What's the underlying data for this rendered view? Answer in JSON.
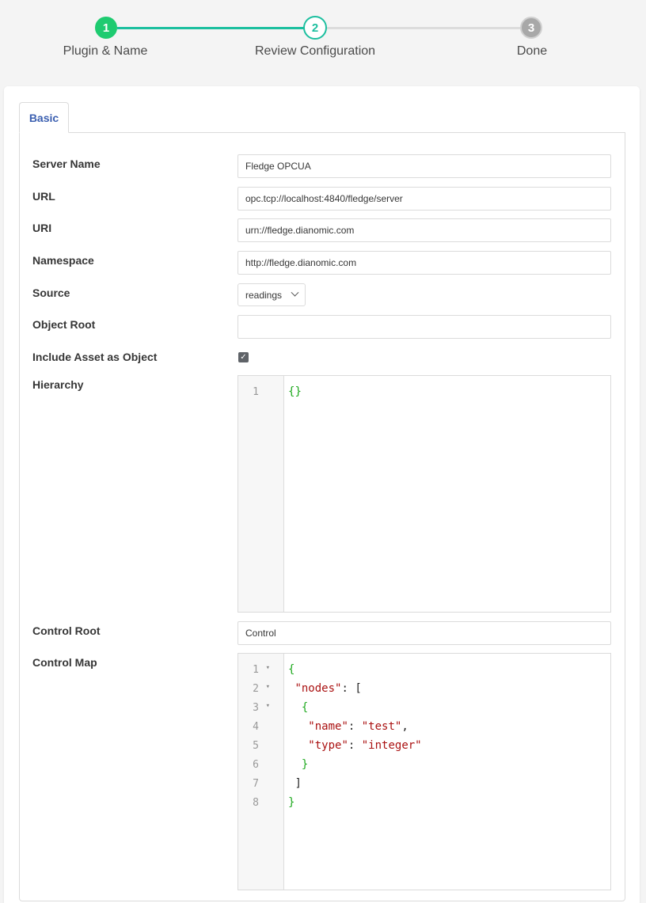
{
  "wizard": {
    "steps": [
      {
        "number": "1",
        "label": "Plugin & Name",
        "state": "complete"
      },
      {
        "number": "2",
        "label": "Review Configuration",
        "state": "active"
      },
      {
        "number": "3",
        "label": "Done",
        "state": "pending"
      }
    ],
    "colors": {
      "complete": "#1ecb70",
      "active": "#1cbf9f",
      "pending": "#a8a8a8"
    }
  },
  "tabs": [
    {
      "label": "Basic",
      "active": true
    }
  ],
  "form": {
    "server_name": {
      "label": "Server Name",
      "value": "Fledge OPCUA"
    },
    "url": {
      "label": "URL",
      "value": "opc.tcp://localhost:4840/fledge/server"
    },
    "uri": {
      "label": "URI",
      "value": "urn://fledge.dianomic.com"
    },
    "namespace": {
      "label": "Namespace",
      "value": "http://fledge.dianomic.com"
    },
    "source": {
      "label": "Source",
      "value": "readings"
    },
    "object_root": {
      "label": "Object Root",
      "value": ""
    },
    "include_asset": {
      "label": "Include Asset as Object",
      "checked": true,
      "icon": "check-icon"
    },
    "hierarchy": {
      "label": "Hierarchy",
      "lines": [
        {
          "n": "1",
          "text": "{}"
        }
      ]
    },
    "control_root": {
      "label": "Control Root",
      "value": "Control"
    },
    "control_map": {
      "label": "Control Map",
      "lines": [
        {
          "n": "1",
          "text": "{"
        },
        {
          "n": "2",
          "text": " \"nodes\": ["
        },
        {
          "n": "3",
          "text": "  {"
        },
        {
          "n": "4",
          "text": "   \"name\": \"test\","
        },
        {
          "n": "5",
          "text": "   \"type\": \"integer\""
        },
        {
          "n": "6",
          "text": "  }"
        },
        {
          "n": "7",
          "text": " ]"
        },
        {
          "n": "8",
          "text": "}"
        }
      ]
    }
  }
}
